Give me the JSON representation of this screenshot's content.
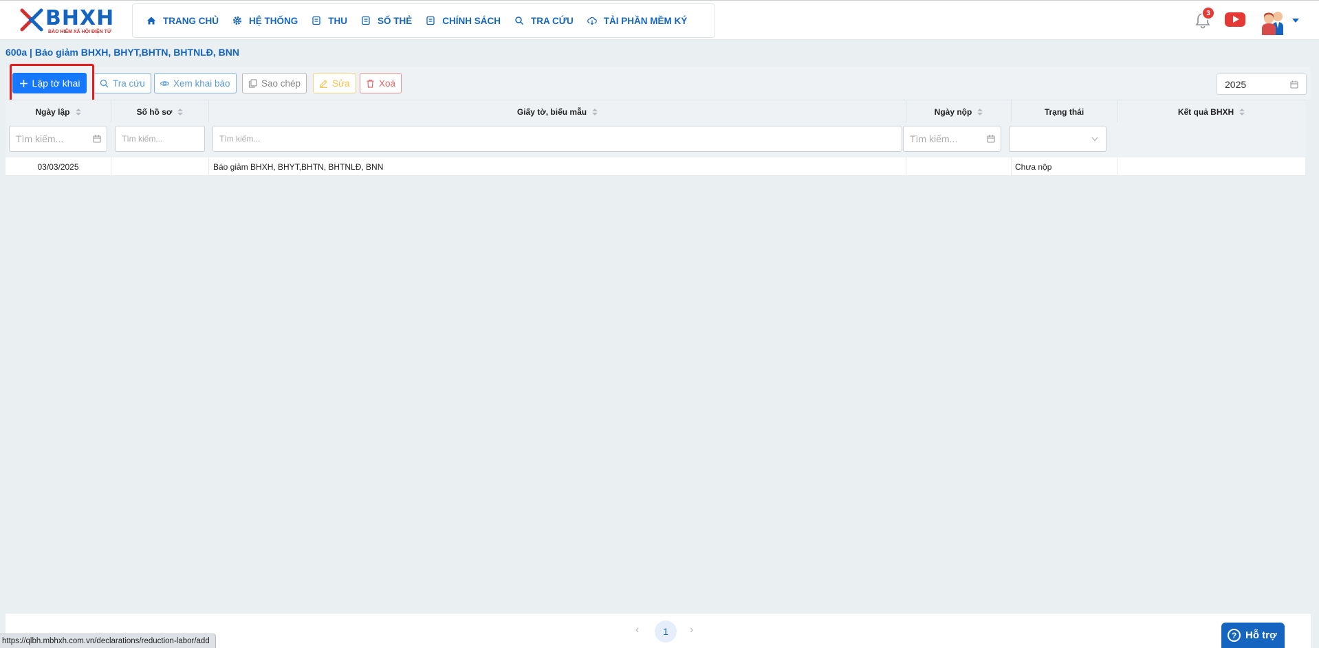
{
  "logo": {
    "text": "BHXH",
    "tagline": "BẢO HIỂM XÃ HỘI ĐIỆN TỬ"
  },
  "nav": [
    {
      "label": "TRANG CHỦ",
      "icon": "home-icon"
    },
    {
      "label": "HỆ THỐNG",
      "icon": "gear-icon"
    },
    {
      "label": "THU",
      "icon": "document-list-icon"
    },
    {
      "label": "SỐ THẺ",
      "icon": "document-list-icon"
    },
    {
      "label": "CHÍNH SÁCH",
      "icon": "document-list-icon"
    },
    {
      "label": "TRA CỨU",
      "icon": "search-icon"
    },
    {
      "label": "TẢI PHẦN MỀM KÝ",
      "icon": "cloud-download-icon"
    }
  ],
  "notifications": {
    "count": "3"
  },
  "page": {
    "title": "600a | Báo giảm BHXH, BHYT,BHTN, BHTNLĐ, BNN"
  },
  "toolbar": {
    "create": "Lập tờ khai",
    "search": "Tra cứu",
    "view": "Xem khai báo",
    "copy": "Sao chép",
    "edit": "Sửa",
    "delete": "Xoá",
    "year": "2025"
  },
  "table": {
    "columns": [
      "Ngày lập",
      "Số hồ sơ",
      "Giấy tờ, biểu mẫu",
      "Ngày nộp",
      "Trạng thái",
      "Kết quả BHXH"
    ],
    "filter_placeholder": "Tìm kiếm...",
    "rows": [
      [
        "03/03/2025",
        "",
        "Báo giảm BHXH, BHYT,BHTN, BHTNLĐ, BNN",
        "",
        "Chưa nộp",
        ""
      ]
    ]
  },
  "pagination": {
    "current": "1"
  },
  "status_url": "https://qlbh.mbhxh.com.vn/declarations/reduction-labor/add",
  "help": {
    "label": "Hỗ trợ"
  },
  "colors": {
    "primary": "#1677ff",
    "brand": "#1565c0",
    "danger": "#e53935",
    "highlight": "#e51c1c"
  }
}
